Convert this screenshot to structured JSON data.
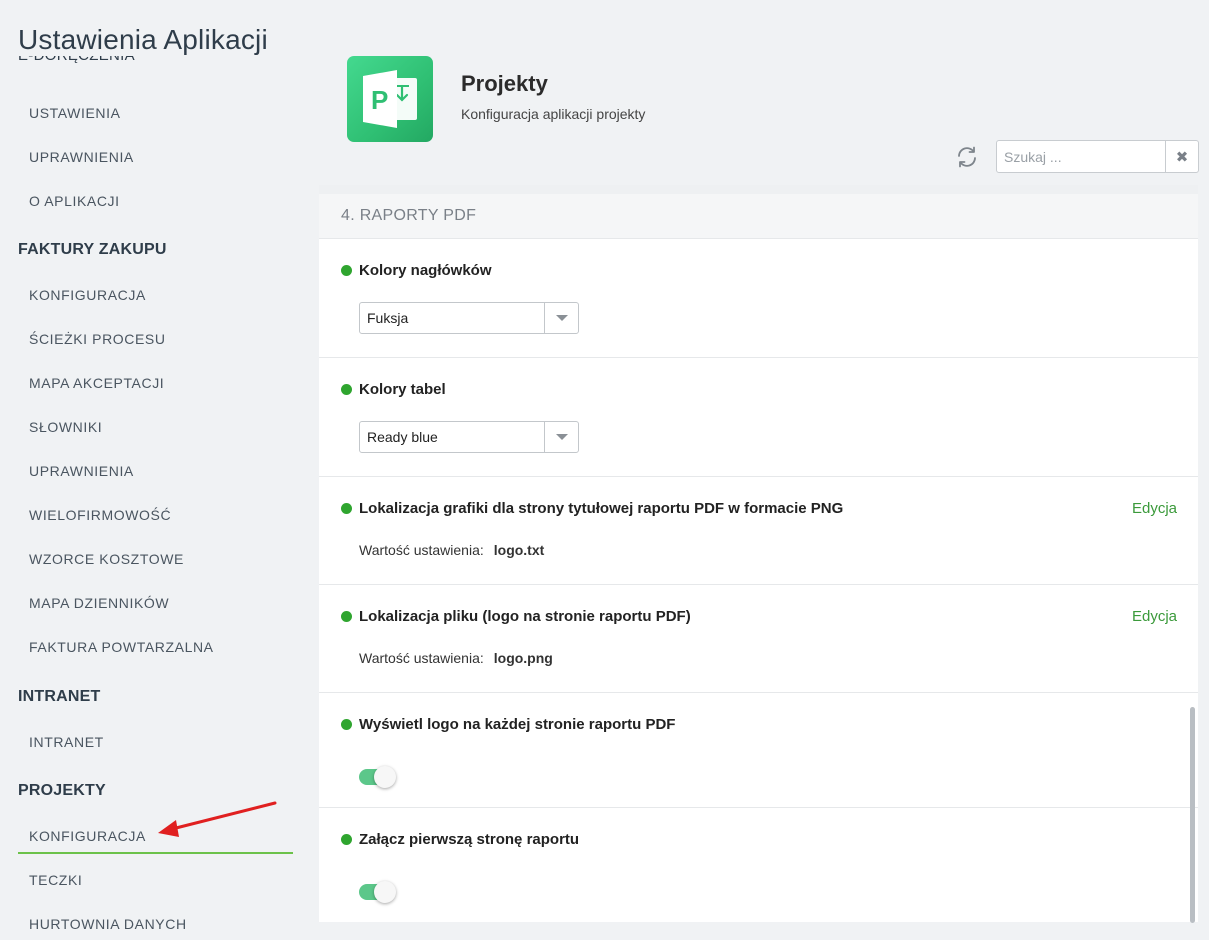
{
  "app_title": "Ustawienia Aplikacji",
  "sidebar": {
    "cut_label": "E-DORĘCZENIA",
    "sections": [
      {
        "label": "FAKTURY ZAKUPU"
      },
      {
        "label": "INTRANET"
      },
      {
        "label": "PROJEKTY"
      }
    ],
    "items": [
      {
        "label": "USTAWIENIA"
      },
      {
        "label": "UPRAWNIENIA"
      },
      {
        "label": "O APLIKACJI"
      },
      {
        "label": "KONFIGURACJA"
      },
      {
        "label": "ŚCIEŻKI PROCESU"
      },
      {
        "label": "MAPA AKCEPTACJI"
      },
      {
        "label": "SŁOWNIKI"
      },
      {
        "label": "UPRAWNIENIA"
      },
      {
        "label": "WIELOFIRMOWOŚĆ"
      },
      {
        "label": "WZORCE KOSZTOWE"
      },
      {
        "label": "MAPA DZIENNIKÓW"
      },
      {
        "label": "FAKTURA POWTARZALNA"
      },
      {
        "label": "INTRANET"
      },
      {
        "label": "KONFIGURACJA",
        "active": true
      },
      {
        "label": "TECZKI"
      },
      {
        "label": "HURTOWNIA DANYCH"
      }
    ]
  },
  "header": {
    "app_name": "Projekty",
    "app_description": "Konfiguracja aplikacji projekty",
    "icon": "ms-project-icon",
    "icon_letter": "P"
  },
  "search": {
    "placeholder": "Szukaj ...",
    "value": "",
    "clear_label": "✖"
  },
  "section": {
    "title": "4. RAPORTY PDF"
  },
  "settings": [
    {
      "title": "Kolory nagłówków",
      "type": "select",
      "value": "Fuksja"
    },
    {
      "title": "Kolory tabel",
      "type": "select",
      "value": "Ready blue"
    },
    {
      "title": "Lokalizacja grafiki dla strony tytułowej raportu PDF w formacie PNG",
      "type": "value",
      "value_label": "Wartość ustawienia:",
      "value": "logo.txt",
      "edit_label": "Edycja"
    },
    {
      "title": "Lokalizacja pliku (logo na stronie raportu PDF)",
      "type": "value",
      "value_label": "Wartość ustawienia:",
      "value": "logo.png",
      "edit_label": "Edycja"
    },
    {
      "title": "Wyświetl logo na każdej stronie raportu PDF",
      "type": "toggle",
      "enabled": true
    },
    {
      "title": "Załącz pierwszą stronę raportu",
      "type": "toggle",
      "enabled": true
    }
  ],
  "colors": {
    "accent_green": "#2fa52f",
    "link_green": "#3b9a3b",
    "active_underline": "#6cc24a",
    "toggle_on": "#5cc78a",
    "annotation_arrow": "#e02020"
  }
}
